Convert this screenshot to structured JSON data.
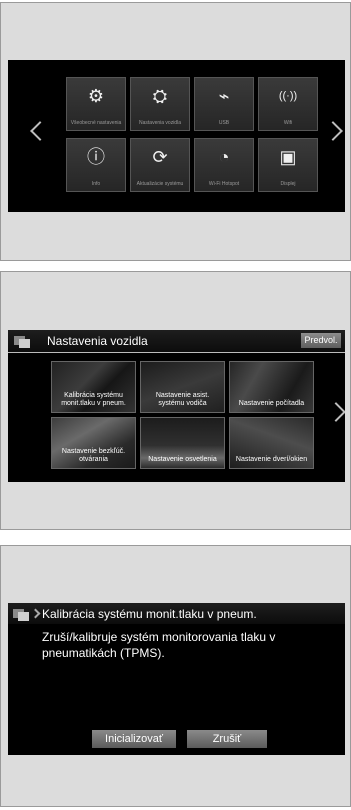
{
  "home": {
    "tiles": [
      {
        "icon": "gear-icon",
        "glyph": "⚙",
        "label": "Všeobecné nastavenia"
      },
      {
        "icon": "car-settings-icon",
        "glyph": "⛭",
        "label": "Nastavenia vozidla"
      },
      {
        "icon": "usb-icon",
        "glyph": "⌁",
        "label": "USB"
      },
      {
        "icon": "wifi-icon",
        "glyph": "((·))",
        "label": "Wifi"
      },
      {
        "icon": "info-icon",
        "glyph": "ⓘ",
        "label": "Info"
      },
      {
        "icon": "refresh-icon",
        "glyph": "⟳",
        "label": "Aktualizácie systému"
      },
      {
        "icon": "wifi-signal-icon",
        "glyph": "◔",
        "label": "Wi-Fi Hotspot"
      },
      {
        "icon": "display-icon",
        "glyph": "▣",
        "label": "Displej"
      }
    ]
  },
  "vehicle": {
    "title": "Nastavenia vozidla",
    "presets": "Predvol.",
    "items": [
      {
        "label": "Kalibrácia systému monit.tlaku v pneum."
      },
      {
        "label": "Nastavenie asist. systému vodiča"
      },
      {
        "label": "Nastavenie počítadla"
      },
      {
        "label": "Nastavenie bezkľúč. otvárania"
      },
      {
        "label": "Nastavenie osvetlenia"
      },
      {
        "label": "Nastavenie dverí/okien"
      }
    ]
  },
  "tpms": {
    "title": "Kalibrácia systému monit.tlaku v pneum.",
    "description": "Zruší/kalibruje systém monitorovania tlaku v pneumatikách (TPMS).",
    "init_label": "Inicializovať",
    "cancel_label": "Zrušiť"
  }
}
